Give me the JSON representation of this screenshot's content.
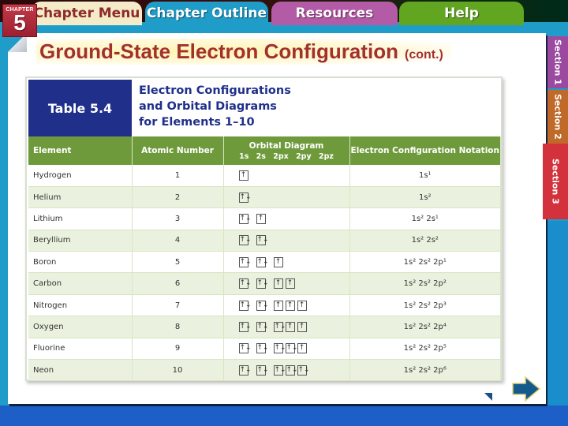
{
  "nav": {
    "chapter_label": "CHAPTER",
    "chapter_number": "5",
    "tabs": [
      {
        "label": "Chapter Menu"
      },
      {
        "label": "Chapter Outline"
      },
      {
        "label": "Resources"
      },
      {
        "label": "Help"
      }
    ]
  },
  "slide": {
    "title": "Ground-State Electron Configuration",
    "title_suffix": "(cont.)"
  },
  "sections": [
    {
      "label": "Section 1"
    },
    {
      "label": "Section 2"
    },
    {
      "label": "Section 3"
    }
  ],
  "table": {
    "number_label": "Table 5.4",
    "title_lines": [
      "Electron Configurations",
      "and Orbital Diagrams",
      "for Elements 1–10"
    ],
    "headers": {
      "element": "Element",
      "atomic_number": "Atomic Number",
      "orbital_diagram": "Orbital Diagram",
      "orbital_sub": "1s 2s 2px 2py 2pz",
      "notation": "Electron Configuration Notation"
    },
    "rows": [
      {
        "element": "Hydrogen",
        "number": "1",
        "orbitals": [
          "↑"
        ],
        "notation": "1s¹"
      },
      {
        "element": "Helium",
        "number": "2",
        "orbitals": [
          "↑↓"
        ],
        "notation": "1s²"
      },
      {
        "element": "Lithium",
        "number": "3",
        "orbitals": [
          "↑↓",
          "↑"
        ],
        "notation": "1s² 2s¹"
      },
      {
        "element": "Beryllium",
        "number": "4",
        "orbitals": [
          "↑↓",
          "↑↓"
        ],
        "notation": "1s² 2s²"
      },
      {
        "element": "Boron",
        "number": "5",
        "orbitals": [
          "↑↓",
          "↑↓",
          "↑"
        ],
        "notation": "1s² 2s² 2p¹"
      },
      {
        "element": "Carbon",
        "number": "6",
        "orbitals": [
          "↑↓",
          "↑↓",
          "↑",
          "↑"
        ],
        "notation": "1s² 2s² 2p²"
      },
      {
        "element": "Nitrogen",
        "number": "7",
        "orbitals": [
          "↑↓",
          "↑↓",
          "↑",
          "↑",
          "↑"
        ],
        "notation": "1s² 2s² 2p³"
      },
      {
        "element": "Oxygen",
        "number": "8",
        "orbitals": [
          "↑↓",
          "↑↓",
          "↑↓",
          "↑",
          "↑"
        ],
        "notation": "1s² 2s² 2p⁴"
      },
      {
        "element": "Fluorine",
        "number": "9",
        "orbitals": [
          "↑↓",
          "↑↓",
          "↑↓",
          "↑↓",
          "↑"
        ],
        "notation": "1s² 2s² 2p⁵"
      },
      {
        "element": "Neon",
        "number": "10",
        "orbitals": [
          "↑↓",
          "↑↓",
          "↑↓",
          "↑↓",
          "↑↓"
        ],
        "notation": "1s² 2s² 2p⁶"
      }
    ]
  },
  "colors": {
    "title_red": "#a33030",
    "table_header_green": "#6f9a3c",
    "table_number_blue": "#1f2f8a",
    "alt_row_green": "#eaf2df"
  },
  "icons": {
    "prev": "previous-slide-icon",
    "next": "next-slide-arrow-icon"
  }
}
